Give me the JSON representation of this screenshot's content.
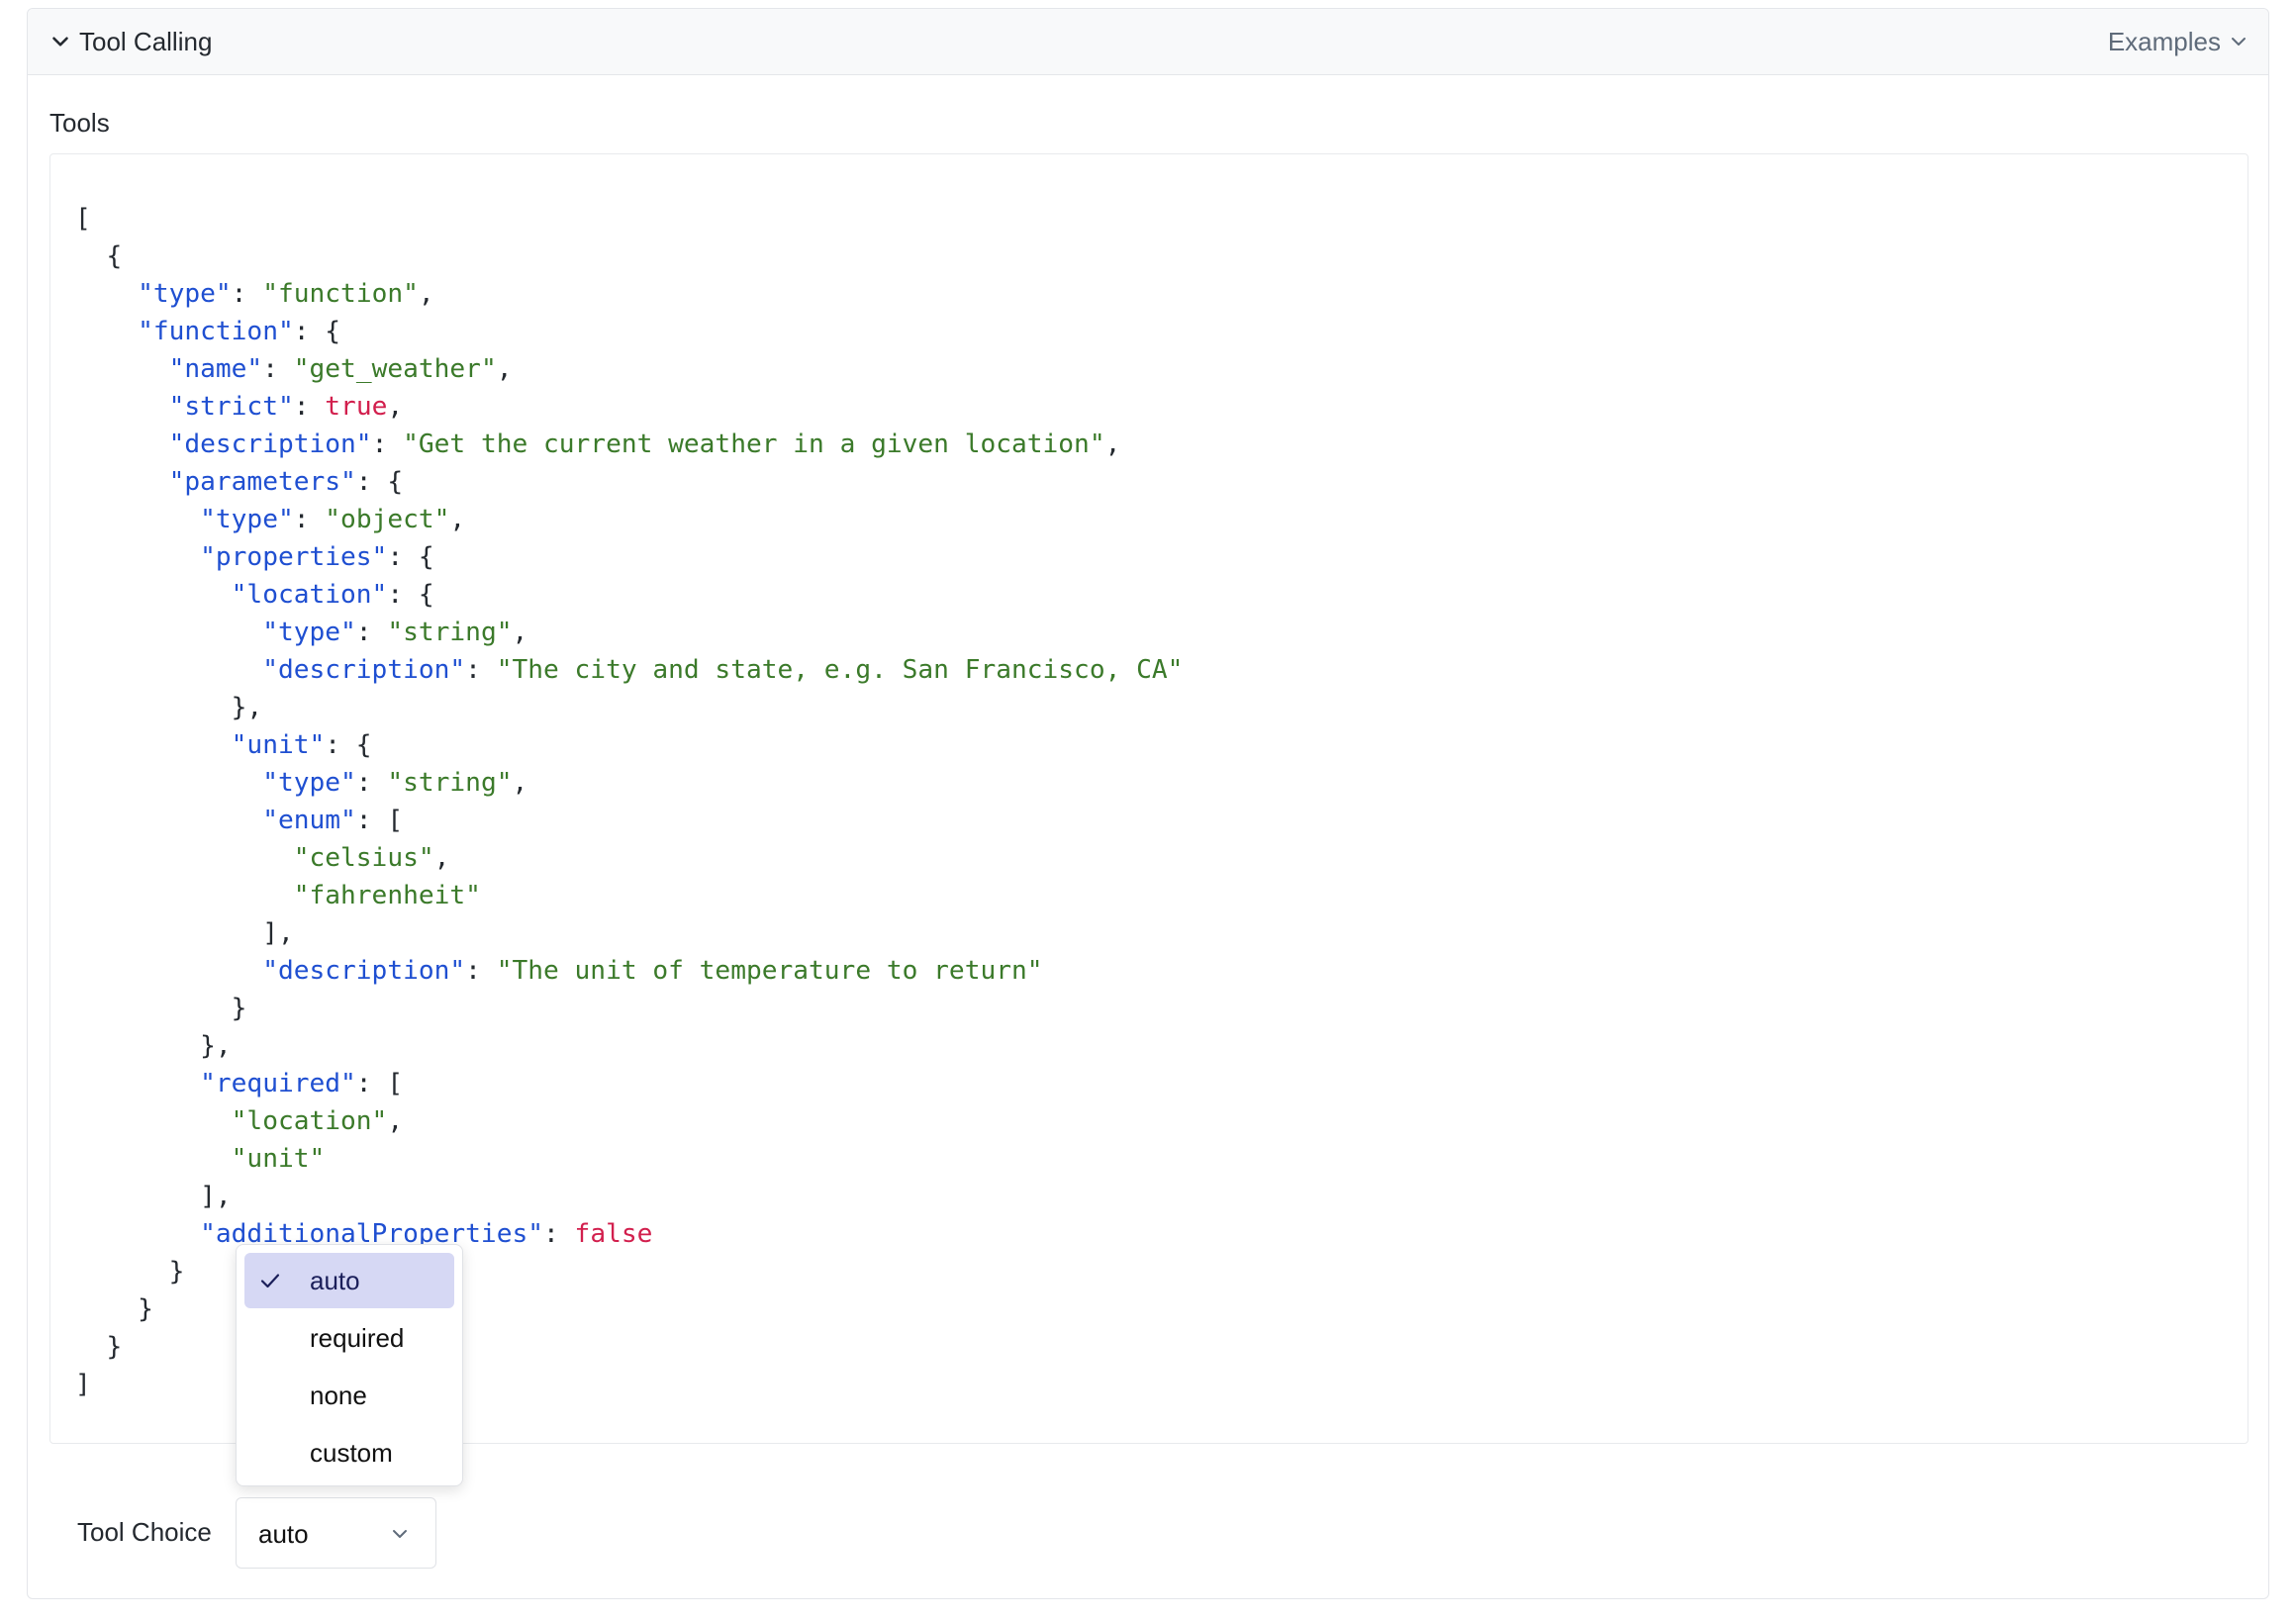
{
  "panel": {
    "title": "Tool Calling",
    "examples_label": "Examples"
  },
  "tools": {
    "label": "Tools",
    "code_lines": [
      [
        {
          "t": "p",
          "v": "["
        }
      ],
      [
        {
          "t": "p",
          "v": "  {"
        }
      ],
      [
        {
          "t": "k",
          "v": "    \"type\""
        },
        {
          "t": "p",
          "v": ": "
        },
        {
          "t": "s",
          "v": "\"function\""
        },
        {
          "t": "p",
          "v": ","
        }
      ],
      [
        {
          "t": "k",
          "v": "    \"function\""
        },
        {
          "t": "p",
          "v": ": {"
        }
      ],
      [
        {
          "t": "k",
          "v": "      \"name\""
        },
        {
          "t": "p",
          "v": ": "
        },
        {
          "t": "s",
          "v": "\"get_weather\""
        },
        {
          "t": "p",
          "v": ","
        }
      ],
      [
        {
          "t": "k",
          "v": "      \"strict\""
        },
        {
          "t": "p",
          "v": ": "
        },
        {
          "t": "b",
          "v": "true"
        },
        {
          "t": "p",
          "v": ","
        }
      ],
      [
        {
          "t": "k",
          "v": "      \"description\""
        },
        {
          "t": "p",
          "v": ": "
        },
        {
          "t": "s",
          "v": "\"Get the current weather in a given location\""
        },
        {
          "t": "p",
          "v": ","
        }
      ],
      [
        {
          "t": "k",
          "v": "      \"parameters\""
        },
        {
          "t": "p",
          "v": ": {"
        }
      ],
      [
        {
          "t": "k",
          "v": "        \"type\""
        },
        {
          "t": "p",
          "v": ": "
        },
        {
          "t": "s",
          "v": "\"object\""
        },
        {
          "t": "p",
          "v": ","
        }
      ],
      [
        {
          "t": "k",
          "v": "        \"properties\""
        },
        {
          "t": "p",
          "v": ": {"
        }
      ],
      [
        {
          "t": "k",
          "v": "          \"location\""
        },
        {
          "t": "p",
          "v": ": {"
        }
      ],
      [
        {
          "t": "k",
          "v": "            \"type\""
        },
        {
          "t": "p",
          "v": ": "
        },
        {
          "t": "s",
          "v": "\"string\""
        },
        {
          "t": "p",
          "v": ","
        }
      ],
      [
        {
          "t": "k",
          "v": "            \"description\""
        },
        {
          "t": "p",
          "v": ": "
        },
        {
          "t": "s",
          "v": "\"The city and state, e.g. San Francisco, CA\""
        }
      ],
      [
        {
          "t": "p",
          "v": "          },"
        }
      ],
      [
        {
          "t": "k",
          "v": "          \"unit\""
        },
        {
          "t": "p",
          "v": ": {"
        }
      ],
      [
        {
          "t": "k",
          "v": "            \"type\""
        },
        {
          "t": "p",
          "v": ": "
        },
        {
          "t": "s",
          "v": "\"string\""
        },
        {
          "t": "p",
          "v": ","
        }
      ],
      [
        {
          "t": "k",
          "v": "            \"enum\""
        },
        {
          "t": "p",
          "v": ": ["
        }
      ],
      [
        {
          "t": "s",
          "v": "              \"celsius\""
        },
        {
          "t": "p",
          "v": ","
        }
      ],
      [
        {
          "t": "s",
          "v": "              \"fahrenheit\""
        }
      ],
      [
        {
          "t": "p",
          "v": "            ],"
        }
      ],
      [
        {
          "t": "k",
          "v": "            \"description\""
        },
        {
          "t": "p",
          "v": ": "
        },
        {
          "t": "s",
          "v": "\"The unit of temperature to return\""
        }
      ],
      [
        {
          "t": "p",
          "v": "          }"
        }
      ],
      [
        {
          "t": "p",
          "v": "        },"
        }
      ],
      [
        {
          "t": "k",
          "v": "        \"required\""
        },
        {
          "t": "p",
          "v": ": ["
        }
      ],
      [
        {
          "t": "s",
          "v": "          \"location\""
        },
        {
          "t": "p",
          "v": ","
        }
      ],
      [
        {
          "t": "s",
          "v": "          \"unit\""
        }
      ],
      [
        {
          "t": "p",
          "v": "        ],"
        }
      ],
      [
        {
          "t": "k",
          "v": "        \"additionalProperties\""
        },
        {
          "t": "p",
          "v": ": "
        },
        {
          "t": "b",
          "v": "false"
        }
      ],
      [
        {
          "t": "p",
          "v": "      }"
        }
      ],
      [
        {
          "t": "p",
          "v": "    }"
        }
      ],
      [
        {
          "t": "p",
          "v": "  }"
        }
      ],
      [
        {
          "t": "p",
          "v": "]"
        }
      ]
    ]
  },
  "tool_choice": {
    "label": "Tool Choice",
    "value": "auto",
    "options": [
      {
        "label": "auto",
        "selected": true
      },
      {
        "label": "required",
        "selected": false
      },
      {
        "label": "none",
        "selected": false
      },
      {
        "label": "custom",
        "selected": false
      }
    ]
  },
  "colors": {
    "key": "#1f4fd1",
    "string": "#3b7a2a",
    "boolean": "#d21f4d",
    "selected_option_bg": "#d6d8f4"
  }
}
